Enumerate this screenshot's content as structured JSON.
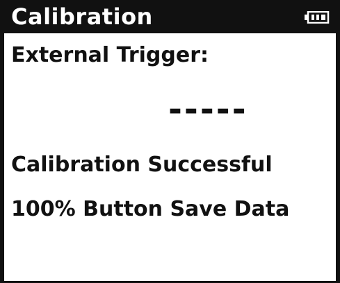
{
  "header": {
    "title": "Calibration",
    "battery_icon": "battery-icon"
  },
  "main": {
    "trigger_label": "External Trigger:",
    "trigger_value": "-----",
    "status": "Calibration Successful",
    "hint": "100% Button Save Data"
  },
  "colors": {
    "foreground": "#111111",
    "background": "#ffffff",
    "title_text": "#ffffff"
  }
}
